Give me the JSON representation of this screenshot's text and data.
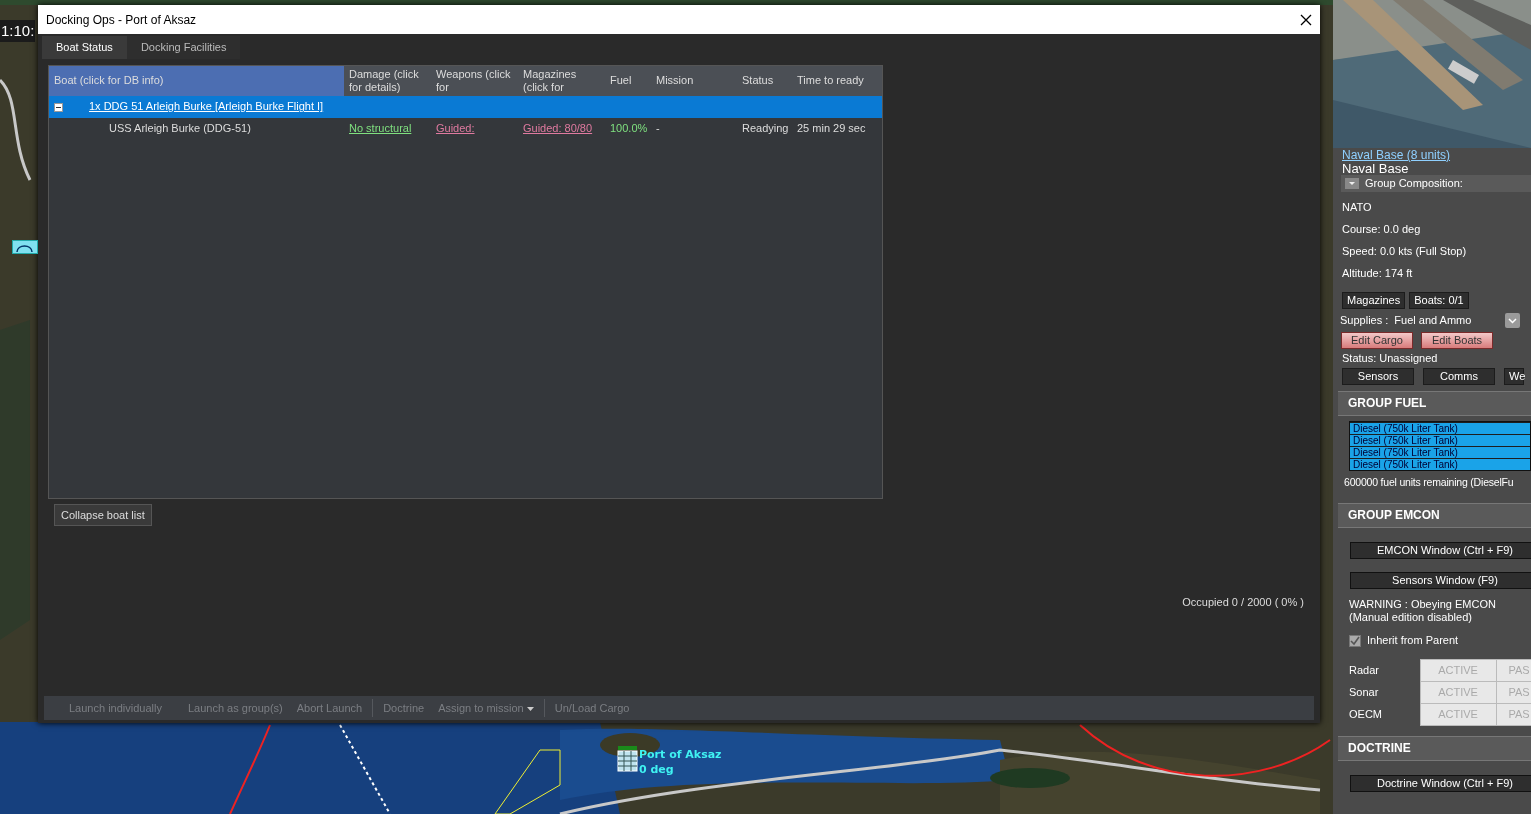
{
  "clock": "1:10:",
  "dialog": {
    "title": "Docking Ops - Port of Aksaz",
    "tabs": [
      {
        "label": "Boat Status",
        "selected": true
      },
      {
        "label": "Docking Facilities",
        "selected": false
      }
    ],
    "table": {
      "columns": [
        "Boat (click for DB info)",
        "Damage (click for details)",
        "Weapons (click for",
        "Magazines (click for",
        "Fuel",
        "Mission",
        "Status",
        "Time to ready"
      ],
      "groups": [
        {
          "label": "1x DDG 51 Arleigh Burke [Arleigh Burke Flight I]",
          "expanded": true,
          "selected": true,
          "rows": [
            {
              "boat": "USS Arleigh Burke (DDG-51)",
              "damage": "No structural",
              "weapons": "Guided:",
              "magazines": "Guided: 80/80",
              "fuel": "100.0%",
              "mission": "-",
              "status": "Readying",
              "time": "25 min 29 sec"
            }
          ]
        }
      ]
    },
    "collapse_button": "Collapse boat list",
    "occupancy": "Occupied 0 / 2000 ( 0% )",
    "toolbar": [
      {
        "label": "Launch individually",
        "kind": "button",
        "disabled": true,
        "separated": false
      },
      {
        "label": "Launch as group(s)",
        "kind": "button",
        "disabled": true,
        "separated": false
      },
      {
        "label": "Abort Launch",
        "kind": "button",
        "disabled": true,
        "separated": false
      },
      {
        "label": "Doctrine",
        "kind": "button",
        "disabled": true,
        "separated": true
      },
      {
        "label": "Assign to mission",
        "kind": "dropdown",
        "disabled": true,
        "separated": false
      },
      {
        "label": "Un/Load Cargo",
        "kind": "button",
        "disabled": true,
        "separated": true
      }
    ]
  },
  "map_labels": [
    "Port of Aksaz",
    "0 deg"
  ],
  "side_panel": {
    "group_link": "Naval Base (8 units)",
    "group_name": "Naval Base",
    "composition": {
      "label": "Group Composition:",
      "expanded": false
    },
    "info": [
      "NATO",
      "Course: 0.0 deg",
      "Speed: 0.0 kts (Full Stop)",
      "Altitude: 174 ft"
    ],
    "buttons": [
      "Magazines",
      "Boats: 0/1"
    ],
    "supplies": {
      "label": "Supplies :",
      "value": "Fuel and Ammo"
    },
    "edit_buttons": [
      "Edit Cargo",
      "Edit Boats"
    ],
    "status": "Status: Unassigned",
    "tabs": [
      "Sensors",
      "Comms",
      "We"
    ],
    "fuel": {
      "title": "GROUP FUEL",
      "tanks": [
        {
          "label": "Diesel (750k Liter Tank)",
          "selected": true
        },
        {
          "label": "Diesel (750k Liter Tank)",
          "selected": true
        },
        {
          "label": "Diesel (750k Liter Tank)",
          "selected": true
        },
        {
          "label": "Diesel (750k Liter Tank)",
          "selected": true
        }
      ],
      "remaining": "600000 fuel units remaining (DieselFu"
    },
    "emcon": {
      "title": "GROUP EMCON",
      "buttons": [
        "EMCON Window (Ctrl + F9)",
        "Sensors Window (F9)"
      ],
      "warning": [
        "WARNING : Obeying EMCON",
        "(Manual edition disabled)"
      ],
      "inherit": {
        "label": "Inherit from Parent",
        "checked": true,
        "disabled": true
      },
      "rows": [
        {
          "sensor": "Radar",
          "active": "ACTIVE",
          "passive": "PAS"
        },
        {
          "sensor": "Sonar",
          "active": "ACTIVE",
          "passive": "PAS"
        },
        {
          "sensor": "OECM",
          "active": "ACTIVE",
          "passive": "PAS"
        }
      ]
    },
    "doctrine": {
      "title": "DOCTRINE",
      "button": "Doctrine Window (Ctrl + F9)"
    }
  }
}
